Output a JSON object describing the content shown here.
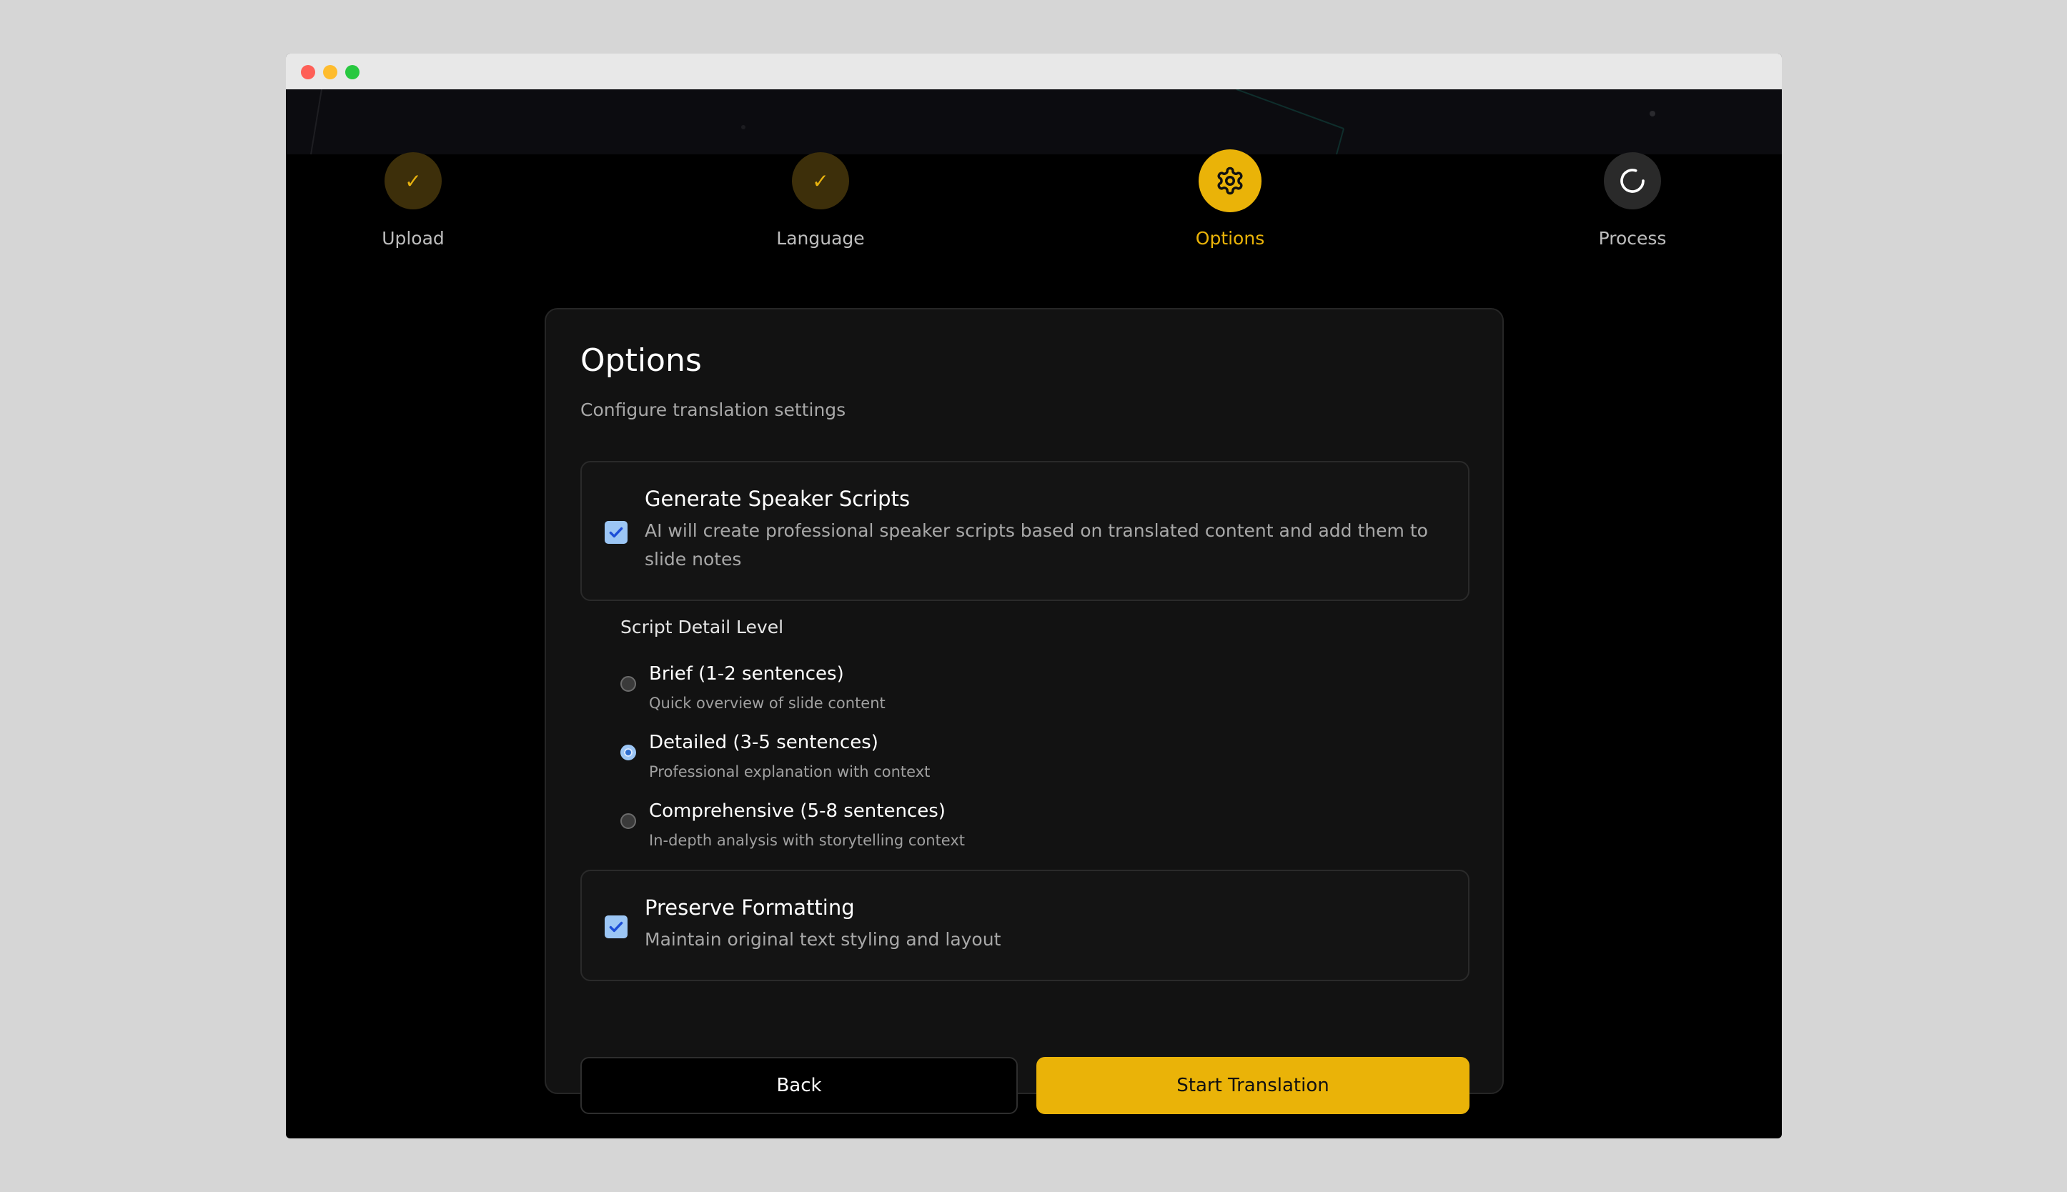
{
  "steps": [
    {
      "label": "Upload",
      "state": "done",
      "icon": "check-icon"
    },
    {
      "label": "Language",
      "state": "done",
      "icon": "check-icon"
    },
    {
      "label": "Options",
      "state": "active",
      "icon": "gear-icon"
    },
    {
      "label": "Process",
      "state": "pending",
      "icon": "spinner-icon"
    }
  ],
  "card": {
    "title": "Options",
    "subtitle": "Configure translation settings"
  },
  "speaker_scripts": {
    "title": "Generate Speaker Scripts",
    "description": "AI will create professional speaker scripts based on translated content and add them to slide notes",
    "checked": true
  },
  "detail_level": {
    "heading": "Script Detail Level",
    "options": [
      {
        "title": "Brief (1-2 sentences)",
        "description": "Quick overview of slide content",
        "selected": false
      },
      {
        "title": "Detailed (3-5 sentences)",
        "description": "Professional explanation with context",
        "selected": true
      },
      {
        "title": "Comprehensive (5-8 sentences)",
        "description": "In-depth analysis with storytelling context",
        "selected": false
      }
    ]
  },
  "preserve_formatting": {
    "title": "Preserve Formatting",
    "description": "Maintain original text styling and layout",
    "checked": true
  },
  "buttons": {
    "back": "Back",
    "start": "Start Translation"
  },
  "colors": {
    "accent": "#eab308",
    "checkbox": "#9cc6f5",
    "background": "#000000",
    "card": "#121212"
  }
}
